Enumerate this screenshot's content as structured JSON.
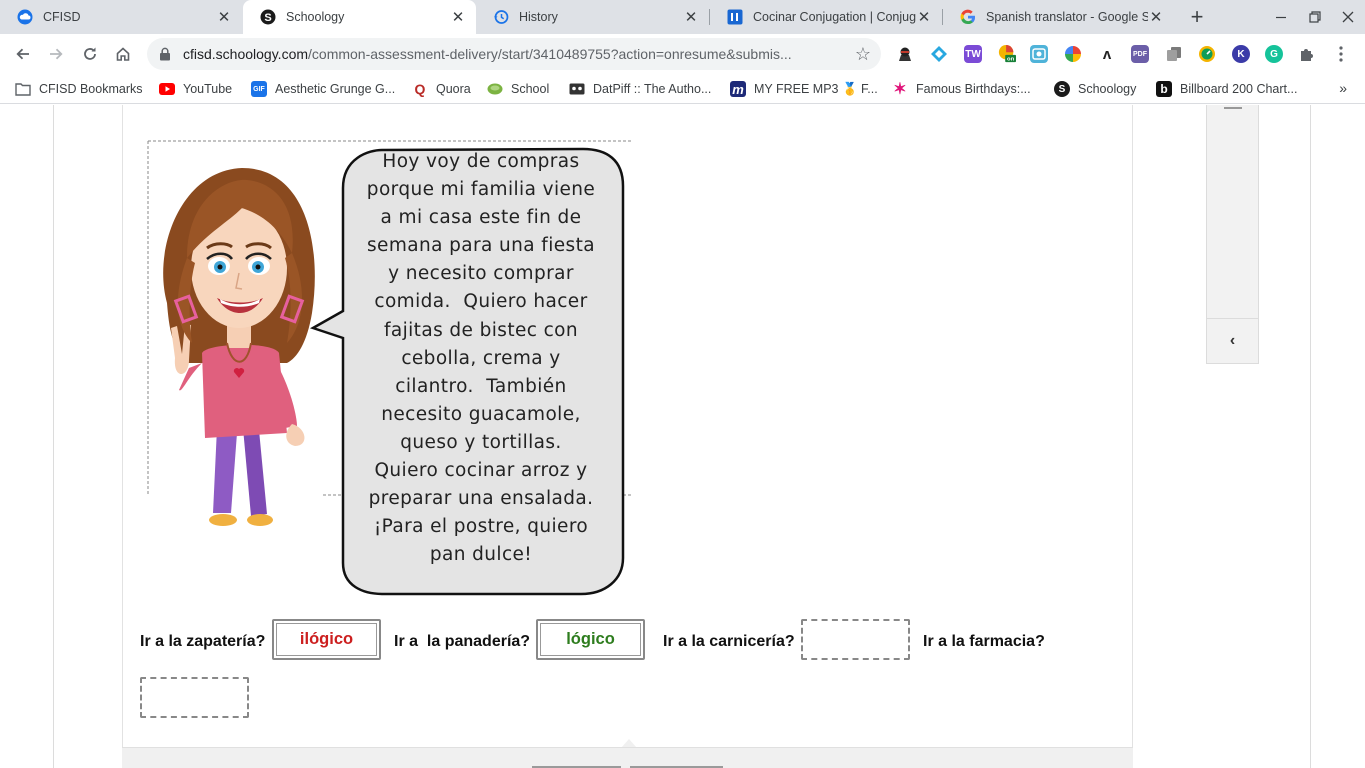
{
  "tabs": [
    {
      "label": "CFISD",
      "icon": "cloud-icon",
      "active": false
    },
    {
      "label": "Schoology",
      "icon": "schoology-icon",
      "active": true
    },
    {
      "label": "History",
      "icon": "history-icon",
      "active": false
    },
    {
      "label": "Cocinar Conjugation | Conjug",
      "icon": "conjugation-site-icon",
      "active": false
    },
    {
      "label": "Spanish translator - Google Se",
      "icon": "google-icon",
      "active": false
    }
  ],
  "omnibox": {
    "domain": "cfisd.schoology.com",
    "path": "/common-assessment-delivery/start/3410489755?action=onresume&submis..."
  },
  "bookmarks": [
    {
      "label": "CFISD Bookmarks",
      "icon": "folder-icon"
    },
    {
      "label": "YouTube",
      "icon": "youtube-icon"
    },
    {
      "label": "Aesthetic Grunge G...",
      "icon": "gif-icon",
      "icon_text": "GIF"
    },
    {
      "label": "Quora",
      "icon": "quora-icon",
      "icon_text": "Q"
    },
    {
      "label": "School",
      "icon": "leaf-icon"
    },
    {
      "label": "DatPiff :: The Autho...",
      "icon": "cassette-icon"
    },
    {
      "label": "MY FREE MP3 🥇 F...",
      "icon": "mp3-icon",
      "icon_text": "m"
    },
    {
      "label": "Famous Birthdays:...",
      "icon": "star-icon",
      "icon_text": "✶"
    },
    {
      "label": "Schoology",
      "icon": "schoology-icon",
      "icon_text": "S"
    },
    {
      "label": "Billboard 200 Chart...",
      "icon": "billboard-icon",
      "icon_text": "b"
    }
  ],
  "bookmarks_more": "»",
  "bubble": {
    "lines": [
      "Hoy voy de compras",
      "porque mi familia viene",
      "a mi casa este fin de",
      "semana para una fiesta",
      "y necesito comprar",
      "comida.  Quiero hacer",
      "fajitas de bistec con",
      "cebolla, crema y",
      "cilantro.  También",
      "necesito guacamole,",
      "queso y tortillas.",
      "Quiero cocinar arroz y",
      "preparar una ensalada.",
      "¡Para el postre, quiero",
      "pan dulce!"
    ]
  },
  "questions": [
    {
      "label": "Ir a la zapatería?",
      "answer": "ilógico",
      "answer_color": "#cc1f1f"
    },
    {
      "label": "Ir a  la panadería?",
      "answer": "lógico",
      "answer_color": "#2e7d1e"
    },
    {
      "label": "Ir a la carnicería?",
      "answer": "",
      "answer_color": "#111111"
    },
    {
      "label": "Ir a la farmacia?",
      "answer": "",
      "answer_color": "#111111"
    }
  ],
  "sidepanel": {
    "collapse_symbol": "‹"
  }
}
